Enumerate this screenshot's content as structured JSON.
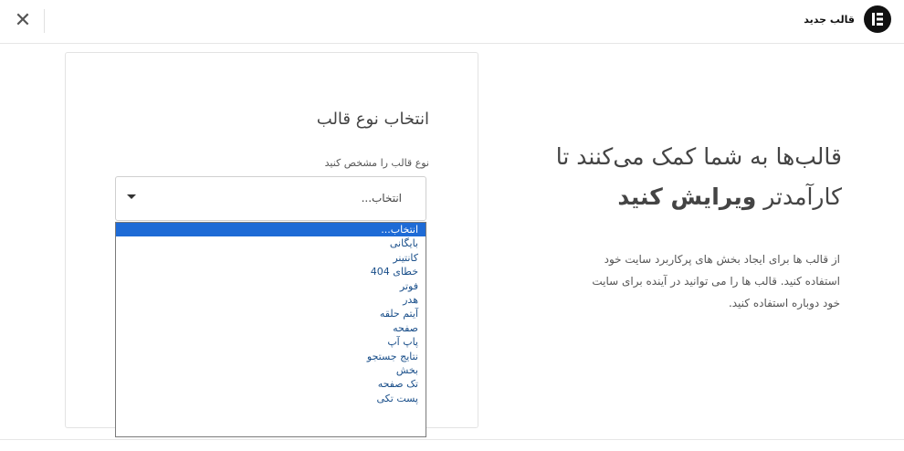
{
  "topbar": {
    "close_glyph": "✕",
    "title": "قالب جدید",
    "logo_icon": "elementor-logo-icon"
  },
  "promo": {
    "heading_line1": "قالب‌ها به شما کمک می‌کنند تا",
    "heading_line2_normal": "کارآمدتر ",
    "heading_line2_bold": "ویرایش کنید",
    "description": "از قالب ها برای ایجاد بخش های پرکاربرد سایت خود استفاده کنید. قالب ها را می توانید در آینده برای سایت خود دوباره استفاده کنید."
  },
  "card": {
    "title": "انتخاب نوع قالب",
    "field_label": "نوع قالب را مشخص کنید",
    "select_value": "انتخاب...",
    "options": [
      "انتخاب...",
      "بایگانی",
      "کانتینر",
      "خطای 404",
      "فوتر",
      "هدر",
      "آیتم حلقه",
      "صفحه",
      "پاپ آپ",
      "نتایج جستجو",
      "بخش",
      "تک صفحه",
      "پست تکی"
    ],
    "selected_index": 0
  },
  "colors": {
    "accent": "#1e6bd6",
    "option_text": "#1a4f8a",
    "logo_bg": "#111111"
  }
}
